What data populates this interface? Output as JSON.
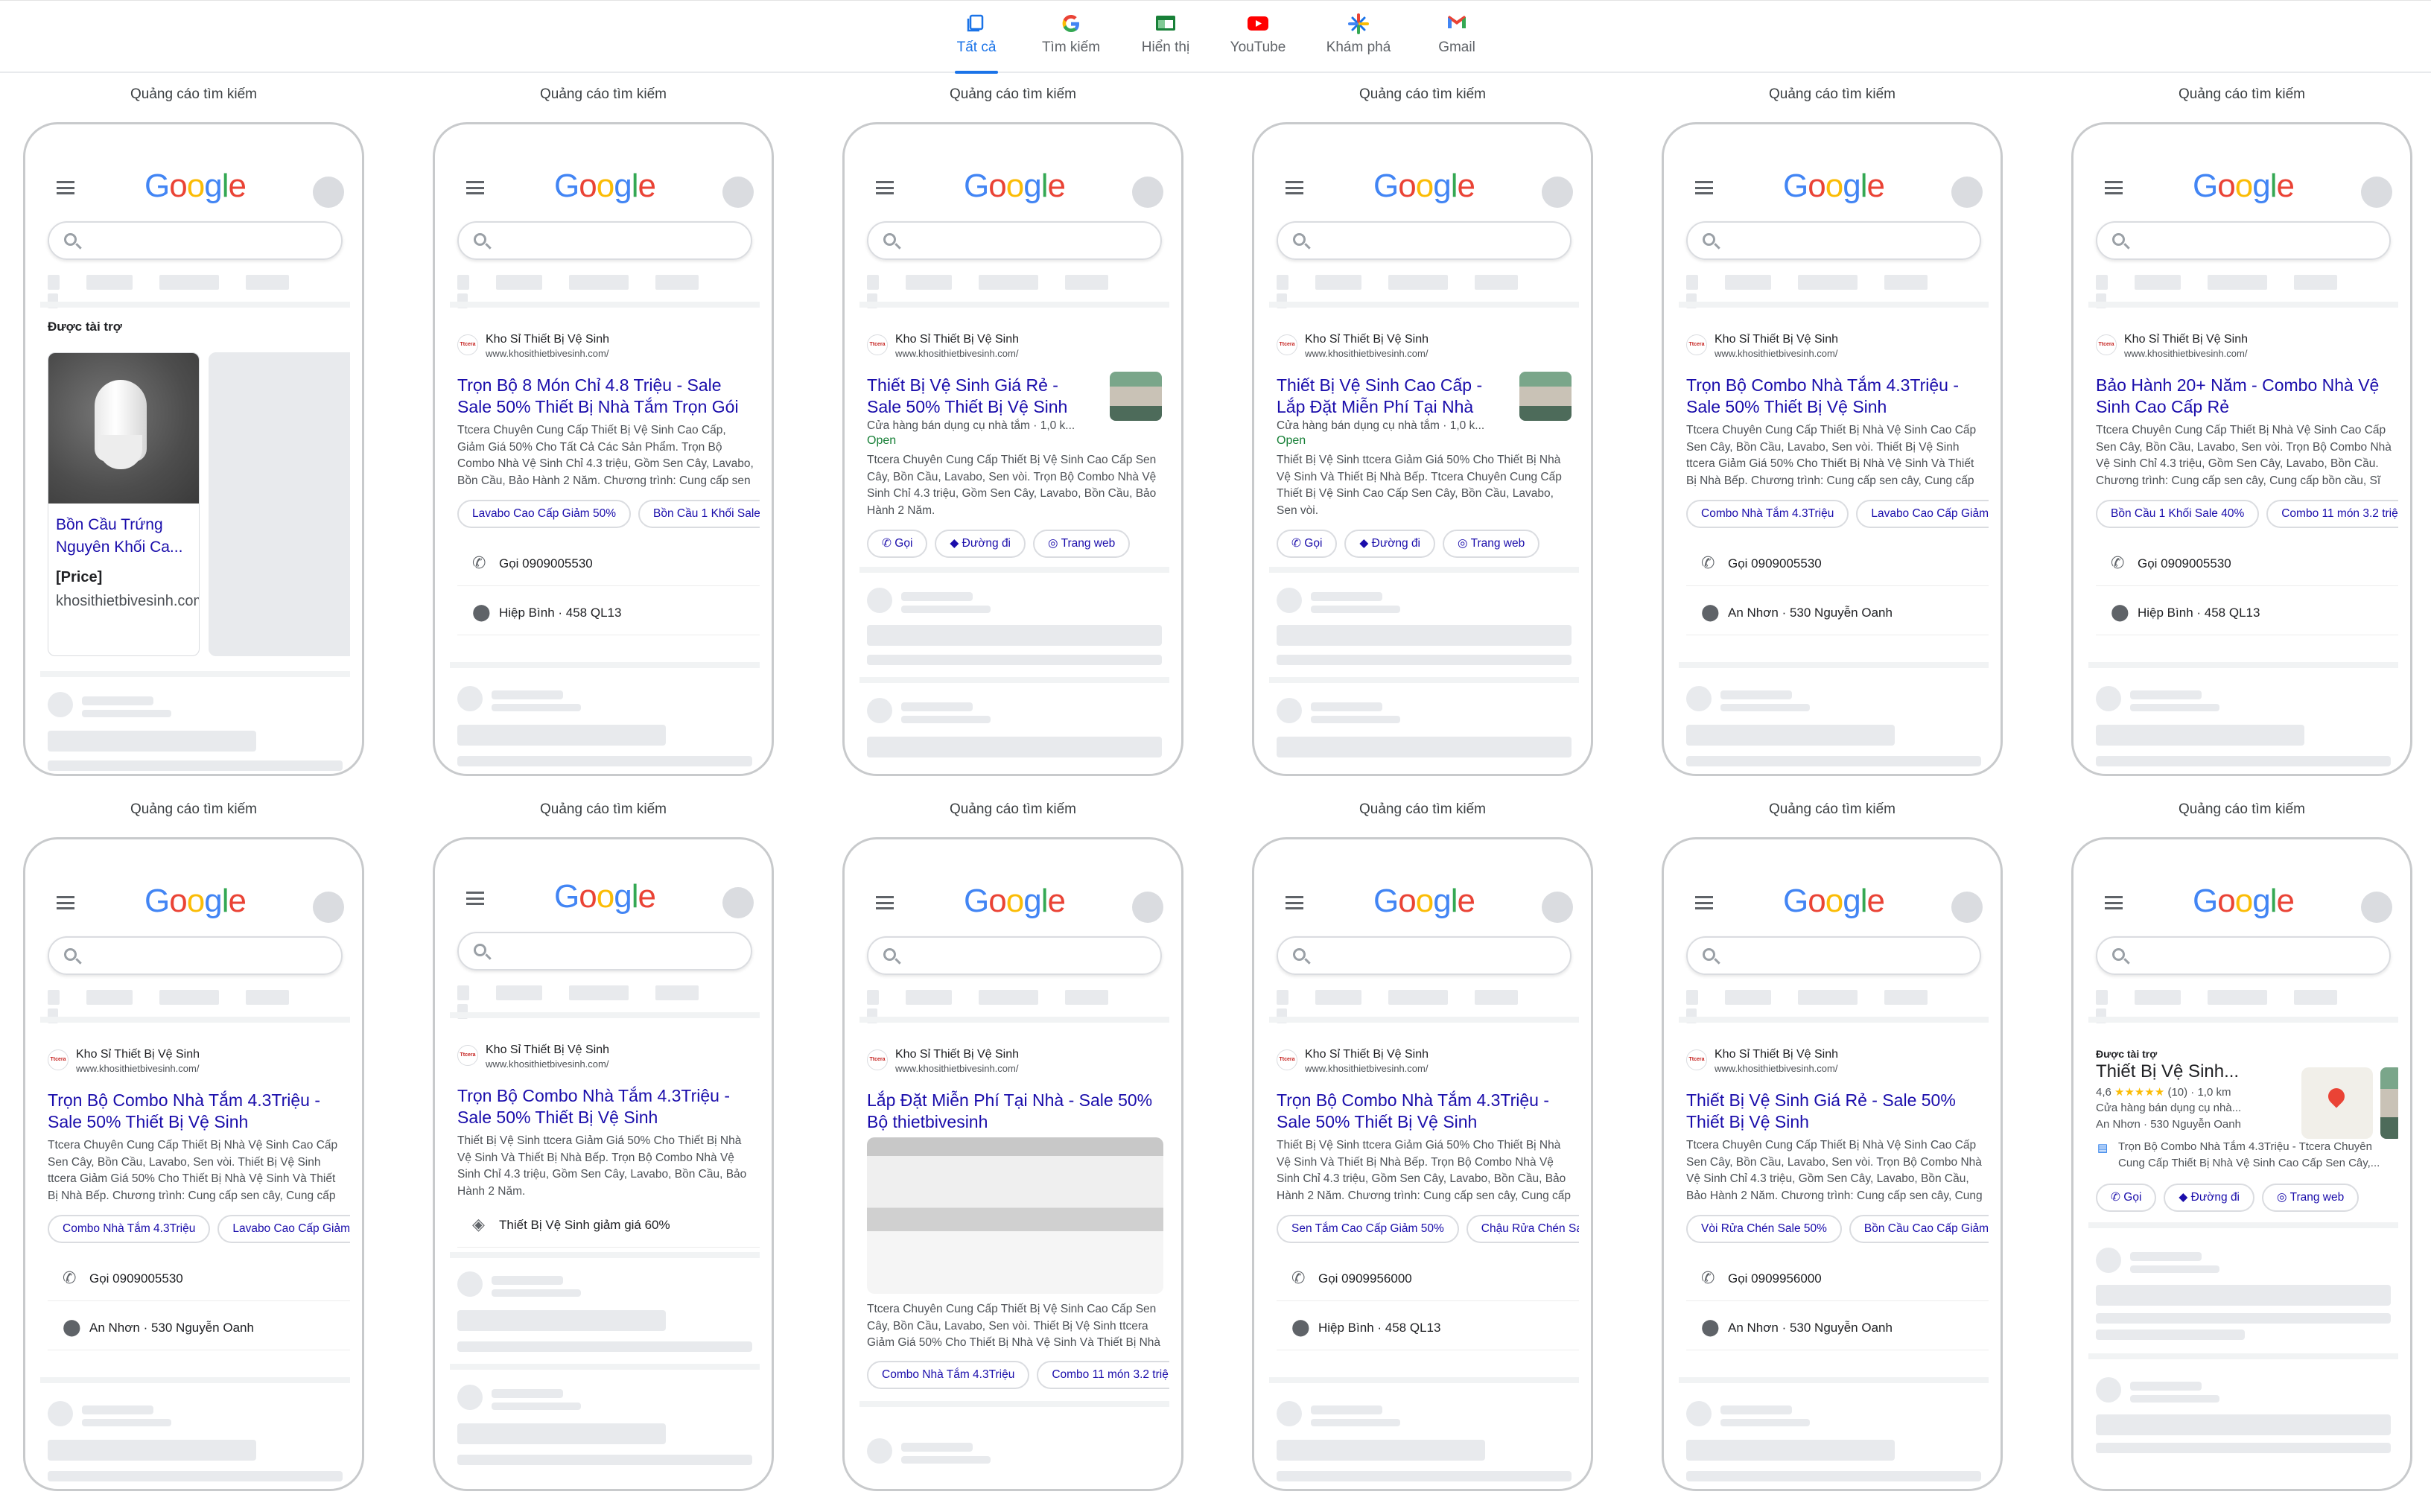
{
  "tabs": [
    {
      "label": "Tất cả",
      "icon": "all-icon",
      "active": true
    },
    {
      "label": "Tìm kiếm",
      "icon": "google-g-icon"
    },
    {
      "label": "Hiển thị",
      "icon": "display-icon"
    },
    {
      "label": "YouTube",
      "icon": "youtube-icon"
    },
    {
      "label": "Khám phá",
      "icon": "discover-icon"
    },
    {
      "label": "Gmail",
      "icon": "gmail-icon"
    }
  ],
  "column_label": "Quảng cáo tìm kiếm",
  "logo": "Google",
  "common": {
    "advertiser": "Kho Sỉ Thiết Bị Vệ Sinh",
    "url": "www.khosithietbivesinh.com/",
    "favicon": "Ttcera",
    "sponsored": "Được tài trợ",
    "call": "Gọi",
    "directions": "Đường đi",
    "website": "Trang web",
    "open": "Open",
    "store_meta": "Cửa hàng bán dụng cụ nhà tắm · 1,0 k..."
  },
  "previews": [
    {
      "shopping": {
        "title": "Bồn Cầu Trứng Nguyên Khối Ca...",
        "price": "[Price]",
        "domain": "khosithietbivesinh.com"
      }
    },
    {
      "title": "Trọn Bộ 8 Món Chỉ 4.8 Triệu - Sale Sale 50% Thiết Bị Nhà Tắm Trọn Gói",
      "desc": "Ttcera Chuyên Cung Cấp Thiết Bị Vệ Sinh Cao Cấp, Giảm Giá 50% Cho Tất Cả Các Sản Phẩm. Trọn Bộ Combo Nhà Vệ Sinh Chỉ 4.3 triệu, Gồm Sen Cây, Lavabo, Bồn Cầu, Bảo Hành 2 Năm. Chương trình: Cung cấp sen cây, Cung cấp bồn cầu, Sĩ phụ kiện vệ...",
      "sitelinks": [
        "Lavabo Cao Cấp Giảm 50%",
        "Bồn Cầu 1 Khối Sale"
      ],
      "phone": "Gọi 0909005530",
      "address": "Hiệp Bình · 458 QL13"
    },
    {
      "title": "Thiết Bị Vệ Sinh Giá Rẻ - Sale 50% Thiết Bị Vệ Sinh",
      "desc": "Ttcera Chuyên Cung Cấp Thiết Bị Vệ Sinh Cao Cấp Sen Cây, Bồn Cầu, Lavabo, Sen vòi. Trọn Bộ Combo Nhà Vệ Sinh Chỉ 4.3 triệu, Gồm Sen Cây, Lavabo, Bồn Cầu, Bảo Hành 2 Năm."
    },
    {
      "title": "Thiết Bị Vệ Sinh Cao Cấp - Lắp Đặt Miễn Phí Tại Nhà",
      "desc": "Thiết Bị Vệ Sinh ttcera Giảm Giá 50% Cho Thiết Bị Nhà Vệ Sinh Và Thiết Bị Nhà Bếp. Ttcera Chuyên Cung Cấp Thiết Bị Vệ Sinh Cao Cấp Sen Cây, Bồn Cầu, Lavabo, Sen vòi."
    },
    {
      "title": "Trọn Bộ Combo Nhà Tắm 4.3Triệu - Sale 50% Thiết Bị Vệ Sinh",
      "desc": "Ttcera Chuyên Cung Cấp Thiết Bị Nhà Vệ Sinh Cao Cấp Sen Cây, Bồn Cầu, Lavabo, Sen vòi. Thiết Bị Vệ Sinh ttcera Giảm Giá 50% Cho Thiết Bị Nhà Vệ Sinh Và Thiết Bị Nhà Bếp. Chương trình: Cung cấp sen cây, Cung cấp bồn cầu, Sĩ phụ kiện vệ sinh.",
      "sitelinks": [
        "Combo Nhà Tắm 4.3Triệu",
        "Lavabo Cao Cấp Giảm"
      ],
      "phone": "Gọi 0909005530",
      "address": "An Nhơn · 530 Nguyễn Oanh"
    },
    {
      "title": "Bảo Hành 20+ Năm - Combo Nhà Vệ Sinh Cao Cấp Rẻ",
      "desc": "Ttcera Chuyên Cung Cấp Thiết Bị Nhà Vệ Sinh Cao Cấp Sen Cây, Bồn Cầu, Lavabo, Sen vòi. Trọn Bộ Combo Nhà Vệ Sinh Chỉ 4.3 triệu, Gồm Sen Cây, Lavabo, Bồn Cầu. Chương trình: Cung cấp sen cây, Cung cấp bồn cầu, Sĩ phụ kiện vệ...",
      "sitelinks": [
        "Bồn Cầu 1 Khối Sale 40%",
        "Combo 11 món 3.2 triệ"
      ],
      "phone": "Gọi 0909005530",
      "address": "Hiệp Bình · 458 QL13"
    },
    {
      "title": "Trọn Bộ Combo Nhà Tắm 4.3Triệu - Sale 50% Thiết Bị Vệ Sinh",
      "desc": "Ttcera Chuyên Cung Cấp Thiết Bị Nhà Vệ Sinh Cao Cấp Sen Cây, Bồn Cầu, Lavabo, Sen vòi. Thiết Bị Vệ Sinh ttcera Giảm Giá 50% Cho Thiết Bị Nhà Vệ Sinh Và Thiết Bị Nhà Bếp. Chương trình: Cung cấp sen cây, Cung cấp bồn cầu, Sĩ phụ kiện vệ sinh.",
      "sitelinks": [
        "Combo Nhà Tắm 4.3Triệu",
        "Lavabo Cao Cấp Giảm"
      ],
      "phone": "Gọi 0909005530",
      "address": "An Nhơn · 530 Nguyễn Oanh"
    },
    {
      "title": "Trọn Bộ Combo Nhà Tắm 4.3Triệu - Sale 50% Thiết Bị Vệ Sinh",
      "desc": "Thiết Bị Vệ Sinh ttcera Giảm Giá 50% Cho Thiết Bị Nhà Vệ Sinh Và Thiết Bị Nhà Bếp. Trọn Bộ Combo Nhà Vệ Sinh Chỉ 4.3 triệu, Gồm Sen Cây, Lavabo, Bồn Cầu, Bảo Hành 2 Năm.",
      "promo": "Thiết Bị Vệ Sinh giảm giá 60%"
    },
    {
      "title": "Lắp Đặt Miễn Phí Tại Nhà - Sale 50% Bộ thietbivesinh",
      "desc": "Ttcera Chuyên Cung Cấp Thiết Bị Vệ Sinh Cao Cấp Sen Cây, Bồn Cầu, Lavabo, Sen vòi. Thiết Bị Vệ Sinh ttcera Giảm Giá 50% Cho Thiết Bị Nhà Vệ Sinh Và Thiết Bị Nhà Bếp.",
      "sitelinks": [
        "Combo Nhà Tắm 4.3Triệu",
        "Combo 11 món 3.2 triệ"
      ]
    },
    {
      "title": "Trọn Bộ Combo Nhà Tắm 4.3Triệu - Sale 50% Thiết Bị Vệ Sinh",
      "desc": "Thiết Bị Vệ Sinh ttcera Giảm Giá 50% Cho Thiết Bị Nhà Vệ Sinh Và Thiết Bị Nhà Bếp. Trọn Bộ Combo Nhà Vệ Sinh Chỉ 4.3 triệu, Gồm Sen Cây, Lavabo, Bồn Cầu, Bảo Hành 2 Năm. Chương trình: Cung cấp sen cây, Cung cấp bồn cầu, Sĩ phụ kiện vệ sinh.",
      "sitelinks": [
        "Sen Tắm Cao Cấp Giảm 50%",
        "Chậu Rửa Chén Sa"
      ],
      "phone": "Gọi 0909956000",
      "address": "Hiệp Bình · 458 QL13"
    },
    {
      "title": "Thiết Bị Vệ Sinh Giá Rẻ - Sale 50% Thiết Bị Vệ Sinh",
      "desc": "Ttcera Chuyên Cung Cấp Thiết Bị Nhà Vệ Sinh Cao Cấp Sen Cây, Bồn Cầu, Lavabo, Sen vòi. Trọn Bộ Combo Nhà Vệ Sinh Chỉ 4.3 triệu, Gồm Sen Cây, Lavabo, Bồn Cầu, Bảo Hành 2 Năm. Chương trình: Cung cấp sen cây, Cung cấp bồn cầu, Sĩ phụ kiện vệ...",
      "sitelinks": [
        "Vòi Rửa Chén Sale 50%",
        "Bồn Cầu Cao Cấp Giảm"
      ],
      "phone": "Gọi 0909956000",
      "address": "An Nhơn · 530 Nguyễn Oanh"
    },
    {
      "local": {
        "name": "Thiết Bị Vệ Sinh...",
        "rating": "4,6",
        "stars": "★★★★★",
        "reviews": "(10) · 1,0 km",
        "category": "Cửa hàng bán dụng cụ nhà...",
        "address": "An Nhơn · 530 Nguyễn Oanh",
        "promo": "Trọn Bộ Combo Nhà Tắm 4.3Triệu - Ttcera Chuyên Cung Cấp Thiết Bị Nhà Vệ Sinh Cao Cấp Sen Cây,..."
      }
    }
  ]
}
